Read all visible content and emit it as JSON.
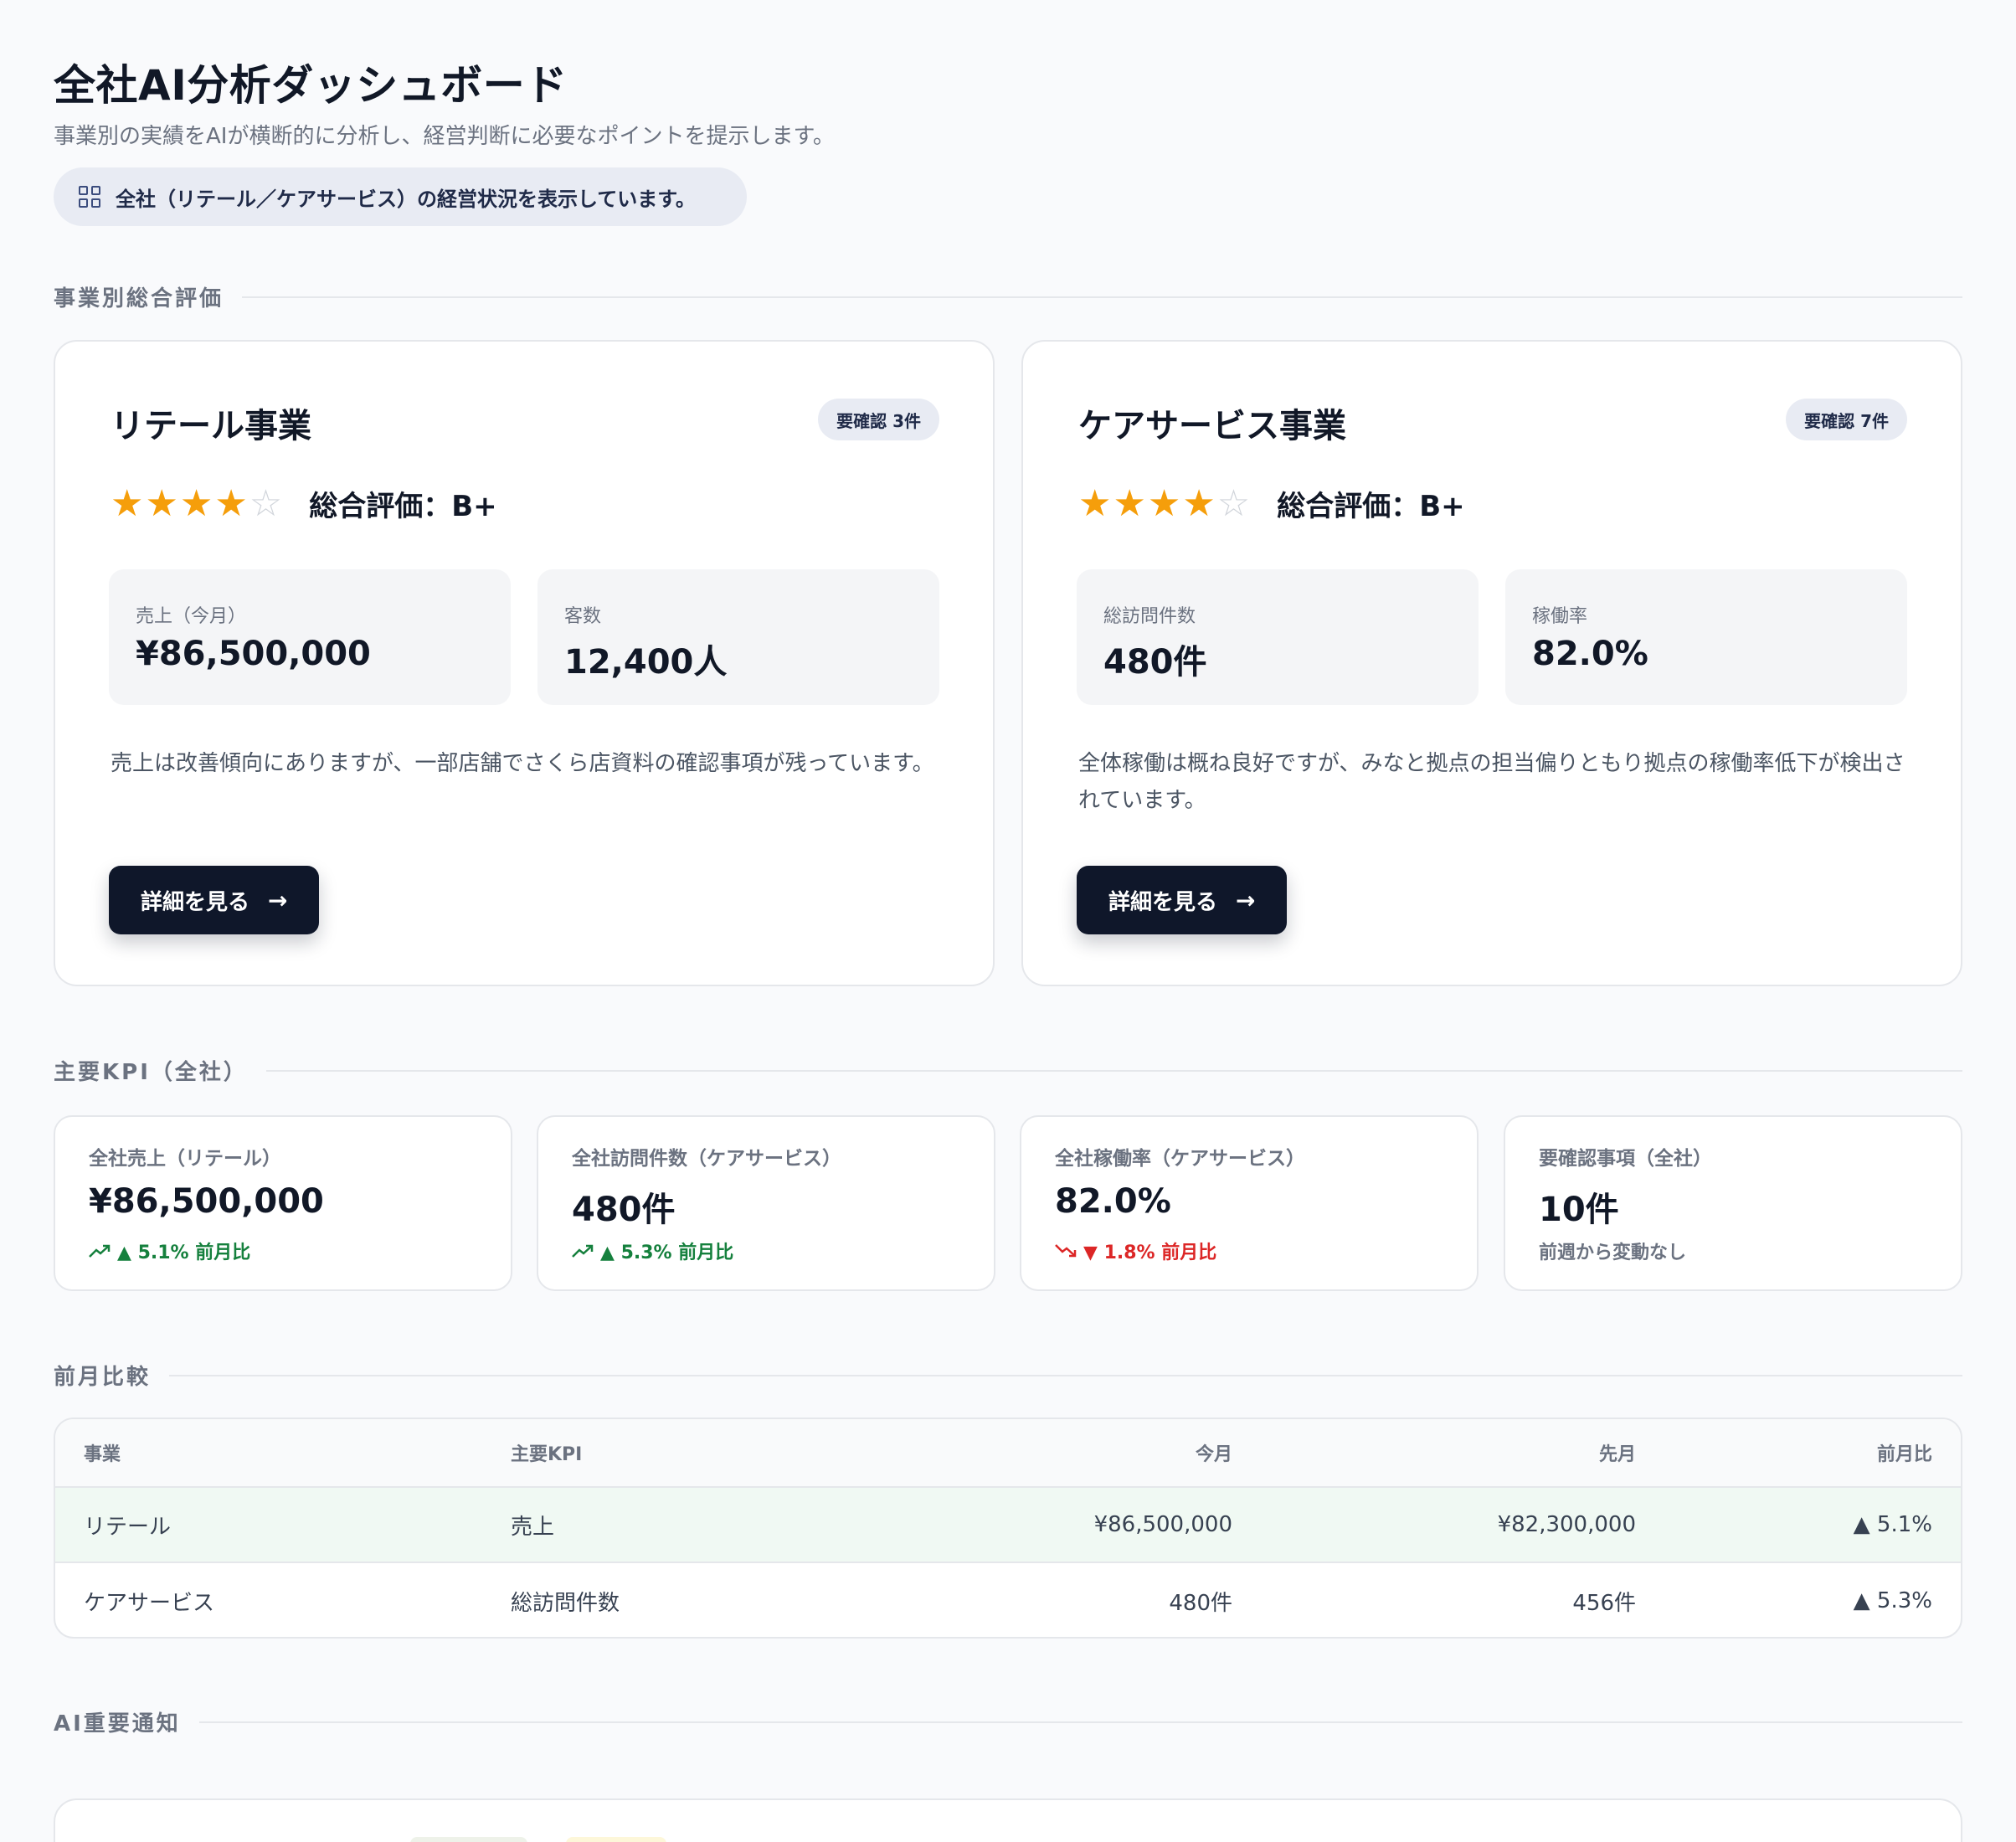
{
  "header": {
    "title": "全社AI分析ダッシュボード",
    "subtitle": "事業別の実績をAIが横断的に分析し、経営判断に必要なポイントを提示します。",
    "scope": "全社（リテール／ケアサービス）の経営状況を表示しています。"
  },
  "sections": {
    "business_eval": "事業別総合評価",
    "kpi": "主要KPI（全社）",
    "comparison": "前月比較",
    "ai_notice": "AI重要通知"
  },
  "business_cards": [
    {
      "name": "リテール事業",
      "badge": "要確認 3件",
      "stars_filled": 4,
      "stars_total": 5,
      "grade": "総合評価：B+",
      "metrics": [
        {
          "label": "売上（今月）",
          "value": "¥86,500,000"
        },
        {
          "label": "客数",
          "value": "12,400人"
        }
      ],
      "description": "売上は改善傾向にありますが、一部店舗でさくら店資料の確認事項が残っています。",
      "button": "詳細を見る"
    },
    {
      "name": "ケアサービス事業",
      "badge": "要確認 7件",
      "stars_filled": 4,
      "stars_total": 5,
      "grade": "総合評価：B+",
      "metrics": [
        {
          "label": "総訪問件数",
          "value": "480件"
        },
        {
          "label": "稼働率",
          "value": "82.0%"
        }
      ],
      "description": "全体稼働は概ね良好ですが、みなと拠点の担当偏りともり拠点の稼働率低下が検出されています。",
      "button": "詳細を見る"
    }
  ],
  "kpis": [
    {
      "label": "全社売上（リテール）",
      "value": "¥86,500,000",
      "change": "▲ 5.1% 前月比",
      "trend": "up"
    },
    {
      "label": "全社訪問件数（ケアサービス）",
      "value": "480件",
      "change": "▲ 5.3% 前月比",
      "trend": "up"
    },
    {
      "label": "全社稼働率（ケアサービス）",
      "value": "82.0%",
      "change": "▼ 1.8% 前月比",
      "trend": "down"
    },
    {
      "label": "要確認事項（全社）",
      "value": "10件",
      "change": "前週から変動なし",
      "trend": "flat"
    }
  ],
  "comparison_table": {
    "headers": [
      "事業",
      "主要KPI",
      "今月",
      "先月",
      "前月比"
    ],
    "rows": [
      [
        "リテール",
        "売上",
        "¥86,500,000",
        "¥82,300,000",
        "▲ 5.1%"
      ],
      [
        "ケアサービス",
        "総訪問件数",
        "480件",
        "456件",
        "▲ 5.3%"
      ]
    ]
  },
  "colors": {
    "background": "#f9fafc",
    "primary_button": "#0f172a",
    "star": "#f59e0b",
    "up": "#15803d",
    "down": "#dc2626",
    "highlight_row": "#f0f9f3"
  },
  "icons": {
    "scope": "grid-icon",
    "button_arrow": "arrow-right-icon",
    "trend_up": "trend-up-icon",
    "trend_down": "trend-down-icon"
  }
}
